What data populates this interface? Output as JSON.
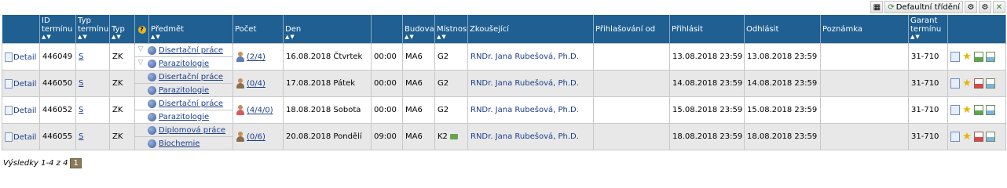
{
  "toolbar": {
    "default_sort_label": "Defaultní třídění"
  },
  "headers": {
    "id": "ID termínu",
    "term_type": "Typ termínu",
    "type": "Typ",
    "help": "?",
    "subject": "Předmět",
    "count": "Počet",
    "day": "Den",
    "building": "Budova",
    "room": "Místnost",
    "examiner": "Zkoušející",
    "reg_from": "Přihlašování od",
    "register": "Přihlásit",
    "unregister": "Odhlásit",
    "note": "Poznámka",
    "guarantor": "Garant termínu",
    "sort_arrows": "▲▼"
  },
  "rows": [
    {
      "detail": "Detail",
      "id": "446049",
      "term_type": "S",
      "type": "ZK",
      "subj1": "Disertační práce",
      "subj2": "Parazitologie",
      "count": "(2/4)",
      "date": "16.08.2018 Čtvrtek",
      "time": "00:00",
      "building": "MA6",
      "room": "G2",
      "examiner": "RNDr. Jana Rubešová, Ph.D.",
      "reg_from": "",
      "register": "13.08.2018 23:59",
      "unregister": "13.08.2018 23:59",
      "note": "",
      "guarantor": "31-710"
    },
    {
      "detail": "Detail",
      "id": "446050",
      "term_type": "S",
      "type": "ZK",
      "subj1": "Disertační práce",
      "subj2": "Parazitologie",
      "count": "(0/4)",
      "date": "17.08.2018 Pátek",
      "time": "00:00",
      "building": "MA6",
      "room": "G2",
      "examiner": "RNDr. Jana Rubešová, Ph.D.",
      "reg_from": "",
      "register": "14.08.2018 23:59",
      "unregister": "14.08.2018 23:59",
      "note": "",
      "guarantor": "31-710"
    },
    {
      "detail": "Detail",
      "id": "446052",
      "term_type": "S",
      "type": "ZK",
      "subj1": "Disertační práce",
      "subj2": "Parazitologie",
      "count": "(4/4/0)",
      "date": "18.08.2018 Sobota",
      "time": "00:00",
      "building": "MA6",
      "room": "G2",
      "examiner": "RNDr. Jana Rubešová, Ph.D.",
      "reg_from": "",
      "register": "15.08.2018 23:59",
      "unregister": "15.08.2018 23:59",
      "note": "",
      "guarantor": "31-710"
    },
    {
      "detail": "Detail",
      "id": "446055",
      "term_type": "S",
      "type": "ZK",
      "subj1": "Diplomová práce",
      "subj2": "Biochemie",
      "count": "(0/6)",
      "date": "20.08.2018 Pondělí",
      "time": "09:00",
      "building": "MA6",
      "room": "K2",
      "examiner": "RNDr. Jana Rubešová, Ph.D.",
      "reg_from": "",
      "register": "18.08.2018 23:59",
      "unregister": "18.08.2018 23:59",
      "note": "",
      "guarantor": "31-710"
    }
  ],
  "footer": {
    "results": "Výsledky 1-4 z 4",
    "page": "1"
  }
}
